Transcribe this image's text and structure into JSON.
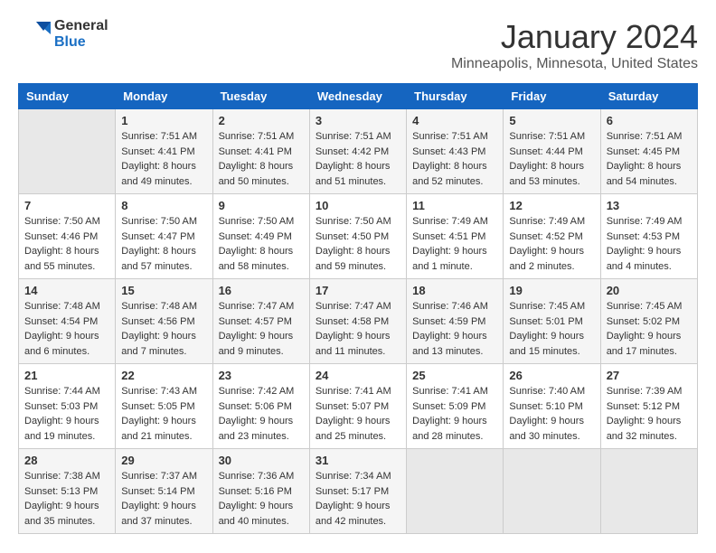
{
  "header": {
    "logo_line1": "General",
    "logo_line2": "Blue",
    "title": "January 2024",
    "subtitle": "Minneapolis, Minnesota, United States"
  },
  "weekdays": [
    "Sunday",
    "Monday",
    "Tuesday",
    "Wednesday",
    "Thursday",
    "Friday",
    "Saturday"
  ],
  "weeks": [
    [
      {
        "day": "",
        "sunrise": "",
        "sunset": "",
        "daylight": ""
      },
      {
        "day": "1",
        "sunrise": "Sunrise: 7:51 AM",
        "sunset": "Sunset: 4:41 PM",
        "daylight": "Daylight: 8 hours and 49 minutes."
      },
      {
        "day": "2",
        "sunrise": "Sunrise: 7:51 AM",
        "sunset": "Sunset: 4:41 PM",
        "daylight": "Daylight: 8 hours and 50 minutes."
      },
      {
        "day": "3",
        "sunrise": "Sunrise: 7:51 AM",
        "sunset": "Sunset: 4:42 PM",
        "daylight": "Daylight: 8 hours and 51 minutes."
      },
      {
        "day": "4",
        "sunrise": "Sunrise: 7:51 AM",
        "sunset": "Sunset: 4:43 PM",
        "daylight": "Daylight: 8 hours and 52 minutes."
      },
      {
        "day": "5",
        "sunrise": "Sunrise: 7:51 AM",
        "sunset": "Sunset: 4:44 PM",
        "daylight": "Daylight: 8 hours and 53 minutes."
      },
      {
        "day": "6",
        "sunrise": "Sunrise: 7:51 AM",
        "sunset": "Sunset: 4:45 PM",
        "daylight": "Daylight: 8 hours and 54 minutes."
      }
    ],
    [
      {
        "day": "7",
        "sunrise": "Sunrise: 7:50 AM",
        "sunset": "Sunset: 4:46 PM",
        "daylight": "Daylight: 8 hours and 55 minutes."
      },
      {
        "day": "8",
        "sunrise": "Sunrise: 7:50 AM",
        "sunset": "Sunset: 4:47 PM",
        "daylight": "Daylight: 8 hours and 57 minutes."
      },
      {
        "day": "9",
        "sunrise": "Sunrise: 7:50 AM",
        "sunset": "Sunset: 4:49 PM",
        "daylight": "Daylight: 8 hours and 58 minutes."
      },
      {
        "day": "10",
        "sunrise": "Sunrise: 7:50 AM",
        "sunset": "Sunset: 4:50 PM",
        "daylight": "Daylight: 8 hours and 59 minutes."
      },
      {
        "day": "11",
        "sunrise": "Sunrise: 7:49 AM",
        "sunset": "Sunset: 4:51 PM",
        "daylight": "Daylight: 9 hours and 1 minute."
      },
      {
        "day": "12",
        "sunrise": "Sunrise: 7:49 AM",
        "sunset": "Sunset: 4:52 PM",
        "daylight": "Daylight: 9 hours and 2 minutes."
      },
      {
        "day": "13",
        "sunrise": "Sunrise: 7:49 AM",
        "sunset": "Sunset: 4:53 PM",
        "daylight": "Daylight: 9 hours and 4 minutes."
      }
    ],
    [
      {
        "day": "14",
        "sunrise": "Sunrise: 7:48 AM",
        "sunset": "Sunset: 4:54 PM",
        "daylight": "Daylight: 9 hours and 6 minutes."
      },
      {
        "day": "15",
        "sunrise": "Sunrise: 7:48 AM",
        "sunset": "Sunset: 4:56 PM",
        "daylight": "Daylight: 9 hours and 7 minutes."
      },
      {
        "day": "16",
        "sunrise": "Sunrise: 7:47 AM",
        "sunset": "Sunset: 4:57 PM",
        "daylight": "Daylight: 9 hours and 9 minutes."
      },
      {
        "day": "17",
        "sunrise": "Sunrise: 7:47 AM",
        "sunset": "Sunset: 4:58 PM",
        "daylight": "Daylight: 9 hours and 11 minutes."
      },
      {
        "day": "18",
        "sunrise": "Sunrise: 7:46 AM",
        "sunset": "Sunset: 4:59 PM",
        "daylight": "Daylight: 9 hours and 13 minutes."
      },
      {
        "day": "19",
        "sunrise": "Sunrise: 7:45 AM",
        "sunset": "Sunset: 5:01 PM",
        "daylight": "Daylight: 9 hours and 15 minutes."
      },
      {
        "day": "20",
        "sunrise": "Sunrise: 7:45 AM",
        "sunset": "Sunset: 5:02 PM",
        "daylight": "Daylight: 9 hours and 17 minutes."
      }
    ],
    [
      {
        "day": "21",
        "sunrise": "Sunrise: 7:44 AM",
        "sunset": "Sunset: 5:03 PM",
        "daylight": "Daylight: 9 hours and 19 minutes."
      },
      {
        "day": "22",
        "sunrise": "Sunrise: 7:43 AM",
        "sunset": "Sunset: 5:05 PM",
        "daylight": "Daylight: 9 hours and 21 minutes."
      },
      {
        "day": "23",
        "sunrise": "Sunrise: 7:42 AM",
        "sunset": "Sunset: 5:06 PM",
        "daylight": "Daylight: 9 hours and 23 minutes."
      },
      {
        "day": "24",
        "sunrise": "Sunrise: 7:41 AM",
        "sunset": "Sunset: 5:07 PM",
        "daylight": "Daylight: 9 hours and 25 minutes."
      },
      {
        "day": "25",
        "sunrise": "Sunrise: 7:41 AM",
        "sunset": "Sunset: 5:09 PM",
        "daylight": "Daylight: 9 hours and 28 minutes."
      },
      {
        "day": "26",
        "sunrise": "Sunrise: 7:40 AM",
        "sunset": "Sunset: 5:10 PM",
        "daylight": "Daylight: 9 hours and 30 minutes."
      },
      {
        "day": "27",
        "sunrise": "Sunrise: 7:39 AM",
        "sunset": "Sunset: 5:12 PM",
        "daylight": "Daylight: 9 hours and 32 minutes."
      }
    ],
    [
      {
        "day": "28",
        "sunrise": "Sunrise: 7:38 AM",
        "sunset": "Sunset: 5:13 PM",
        "daylight": "Daylight: 9 hours and 35 minutes."
      },
      {
        "day": "29",
        "sunrise": "Sunrise: 7:37 AM",
        "sunset": "Sunset: 5:14 PM",
        "daylight": "Daylight: 9 hours and 37 minutes."
      },
      {
        "day": "30",
        "sunrise": "Sunrise: 7:36 AM",
        "sunset": "Sunset: 5:16 PM",
        "daylight": "Daylight: 9 hours and 40 minutes."
      },
      {
        "day": "31",
        "sunrise": "Sunrise: 7:34 AM",
        "sunset": "Sunset: 5:17 PM",
        "daylight": "Daylight: 9 hours and 42 minutes."
      },
      {
        "day": "",
        "sunrise": "",
        "sunset": "",
        "daylight": ""
      },
      {
        "day": "",
        "sunrise": "",
        "sunset": "",
        "daylight": ""
      },
      {
        "day": "",
        "sunrise": "",
        "sunset": "",
        "daylight": ""
      }
    ]
  ]
}
